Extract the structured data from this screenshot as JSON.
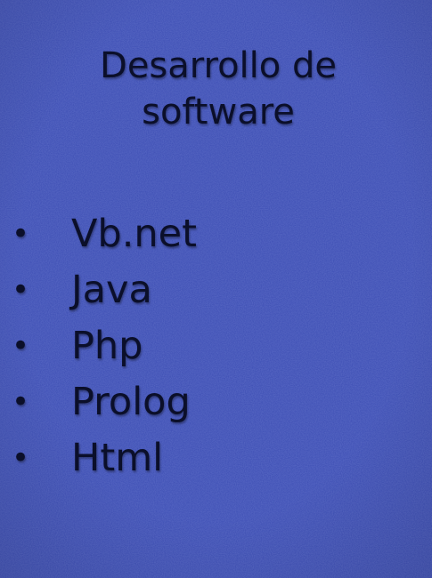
{
  "slide": {
    "background_color": "#3d4fb5",
    "text_color": "#0b0f2a",
    "title": {
      "line1": "Desarrollo de",
      "line2": "software"
    },
    "bullet_glyph": "•",
    "items": [
      {
        "label": "Vb.net"
      },
      {
        "label": "Java"
      },
      {
        "label": "Php"
      },
      {
        "label": "Prolog"
      },
      {
        "label": "Html"
      }
    ]
  }
}
